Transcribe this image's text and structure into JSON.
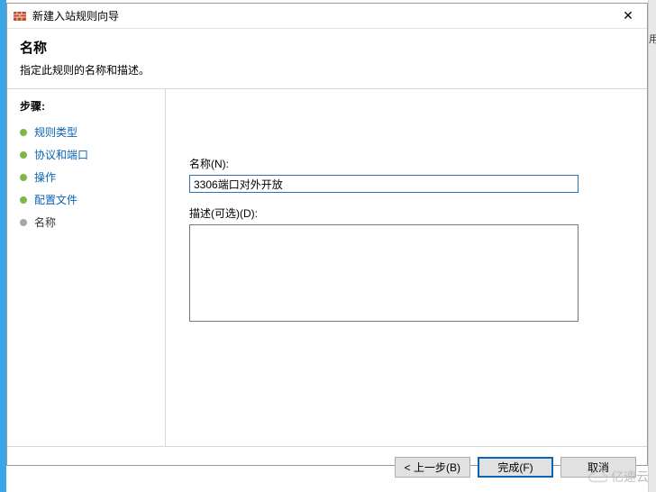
{
  "titlebar": {
    "title": "新建入站规则向导",
    "close_glyph": "✕"
  },
  "header": {
    "heading": "名称",
    "description": "指定此规则的名称和描述。"
  },
  "sidebar": {
    "steps_title": "步骤:",
    "items": [
      {
        "label": "规则类型",
        "href": true
      },
      {
        "label": "协议和端口",
        "href": true
      },
      {
        "label": "操作",
        "href": true
      },
      {
        "label": "配置文件",
        "href": true
      },
      {
        "label": "名称",
        "href": false
      }
    ]
  },
  "form": {
    "name_label": "名称(N):",
    "name_value": "3306端口对外开放",
    "desc_label": "描述(可选)(D):",
    "desc_value": ""
  },
  "footer": {
    "back": "< 上一步(B)",
    "finish": "完成(F)",
    "cancel": "取消"
  },
  "right_strip": {
    "char": "用"
  },
  "watermark": {
    "text": "亿速云"
  }
}
